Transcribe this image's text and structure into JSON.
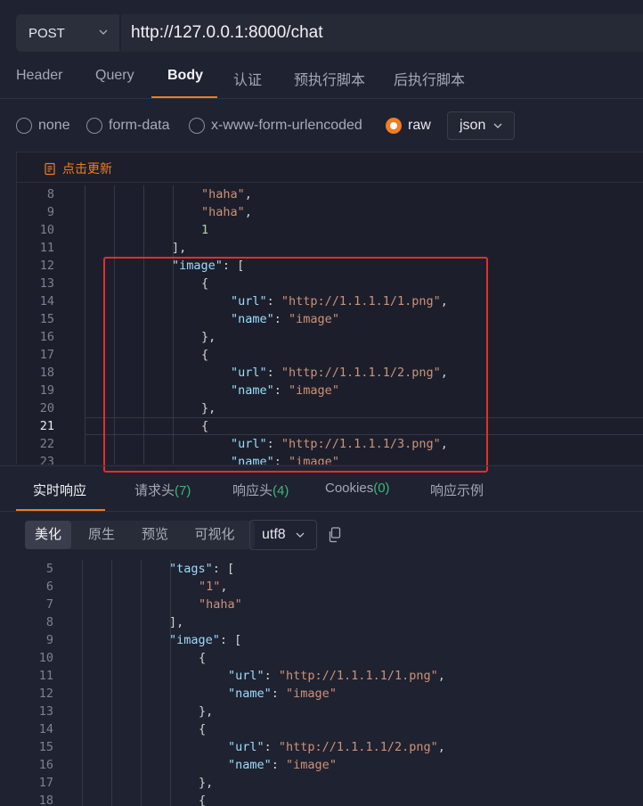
{
  "request": {
    "method": "POST",
    "url": "http://127.0.0.1:8000/chat",
    "tabs": [
      "Header",
      "Query",
      "Body",
      "认证",
      "预执行脚本",
      "后执行脚本"
    ],
    "active_tab": "Body"
  },
  "body_types": [
    "none",
    "form-data",
    "x-www-form-urlencoded",
    "raw"
  ],
  "body_type_selected": "raw",
  "raw_format": "json",
  "editor": {
    "update_label": "点击更新",
    "lines": [
      {
        "n": "8",
        "indent": 4,
        "parts": [
          [
            "s",
            "\"haha\""
          ],
          [
            "p",
            ","
          ]
        ]
      },
      {
        "n": "9",
        "indent": 4,
        "parts": [
          [
            "s",
            "\"haha\""
          ],
          [
            "p",
            ","
          ]
        ]
      },
      {
        "n": "10",
        "indent": 4,
        "parts": [
          [
            "n",
            "1"
          ]
        ]
      },
      {
        "n": "11",
        "indent": 3,
        "parts": [
          [
            "p",
            "],"
          ]
        ]
      },
      {
        "n": "12",
        "indent": 3,
        "parts": [
          [
            "k",
            "\"image\""
          ],
          [
            "p",
            ": ["
          ]
        ]
      },
      {
        "n": "13",
        "indent": 4,
        "parts": [
          [
            "p",
            "{"
          ]
        ]
      },
      {
        "n": "14",
        "indent": 5,
        "parts": [
          [
            "k",
            "\"url\""
          ],
          [
            "p",
            ": "
          ],
          [
            "s",
            "\"http://1.1.1.1/1.png\""
          ],
          [
            "p",
            ","
          ]
        ]
      },
      {
        "n": "15",
        "indent": 5,
        "parts": [
          [
            "k",
            "\"name\""
          ],
          [
            "p",
            ": "
          ],
          [
            "s",
            "\"image\""
          ]
        ]
      },
      {
        "n": "16",
        "indent": 4,
        "parts": [
          [
            "p",
            "},"
          ]
        ]
      },
      {
        "n": "17",
        "indent": 4,
        "parts": [
          [
            "p",
            "{"
          ]
        ]
      },
      {
        "n": "18",
        "indent": 5,
        "parts": [
          [
            "k",
            "\"url\""
          ],
          [
            "p",
            ": "
          ],
          [
            "s",
            "\"http://1.1.1.1/2.png\""
          ],
          [
            "p",
            ","
          ]
        ]
      },
      {
        "n": "19",
        "indent": 5,
        "parts": [
          [
            "k",
            "\"name\""
          ],
          [
            "p",
            ": "
          ],
          [
            "s",
            "\"image\""
          ]
        ]
      },
      {
        "n": "20",
        "indent": 4,
        "parts": [
          [
            "p",
            "},"
          ]
        ]
      },
      {
        "n": "21",
        "indent": 4,
        "parts": [
          [
            "p",
            "{"
          ]
        ]
      },
      {
        "n": "22",
        "indent": 5,
        "parts": [
          [
            "k",
            "\"url\""
          ],
          [
            "p",
            ": "
          ],
          [
            "s",
            "\"http://1.1.1.1/3.png\""
          ],
          [
            "p",
            ","
          ]
        ]
      },
      {
        "n": "23",
        "indent": 5,
        "parts": [
          [
            "k",
            "\"name\""
          ],
          [
            "p",
            ": "
          ],
          [
            "s",
            "\"image\""
          ]
        ]
      }
    ],
    "current_line": "21"
  },
  "response": {
    "tabs": [
      {
        "label": "实时响应",
        "count": ""
      },
      {
        "label": "请求头",
        "count": "(7)"
      },
      {
        "label": "响应头",
        "count": "(4)"
      },
      {
        "label": "Cookies",
        "count": "(0)"
      },
      {
        "label": "响应示例",
        "count": ""
      }
    ],
    "active_tab": "实时响应",
    "view_modes": [
      "美化",
      "原生",
      "预览",
      "可视化"
    ],
    "active_view": "美化",
    "encoding": "utf8",
    "lines": [
      {
        "n": "5",
        "indent": 3,
        "parts": [
          [
            "k",
            "\"tags\""
          ],
          [
            "p",
            ": ["
          ]
        ]
      },
      {
        "n": "6",
        "indent": 4,
        "parts": [
          [
            "s",
            "\"1\""
          ],
          [
            "p",
            ","
          ]
        ]
      },
      {
        "n": "7",
        "indent": 4,
        "parts": [
          [
            "s",
            "\"haha\""
          ]
        ]
      },
      {
        "n": "8",
        "indent": 3,
        "parts": [
          [
            "p",
            "],"
          ]
        ]
      },
      {
        "n": "9",
        "indent": 3,
        "parts": [
          [
            "k",
            "\"image\""
          ],
          [
            "p",
            ": ["
          ]
        ]
      },
      {
        "n": "10",
        "indent": 4,
        "parts": [
          [
            "p",
            "{"
          ]
        ]
      },
      {
        "n": "11",
        "indent": 5,
        "parts": [
          [
            "k",
            "\"url\""
          ],
          [
            "p",
            ": "
          ],
          [
            "s",
            "\"http://1.1.1.1/1.png\""
          ],
          [
            "p",
            ","
          ]
        ]
      },
      {
        "n": "12",
        "indent": 5,
        "parts": [
          [
            "k",
            "\"name\""
          ],
          [
            "p",
            ": "
          ],
          [
            "s",
            "\"image\""
          ]
        ]
      },
      {
        "n": "13",
        "indent": 4,
        "parts": [
          [
            "p",
            "},"
          ]
        ]
      },
      {
        "n": "14",
        "indent": 4,
        "parts": [
          [
            "p",
            "{"
          ]
        ]
      },
      {
        "n": "15",
        "indent": 5,
        "parts": [
          [
            "k",
            "\"url\""
          ],
          [
            "p",
            ": "
          ],
          [
            "s",
            "\"http://1.1.1.1/2.png\""
          ],
          [
            "p",
            ","
          ]
        ]
      },
      {
        "n": "16",
        "indent": 5,
        "parts": [
          [
            "k",
            "\"name\""
          ],
          [
            "p",
            ": "
          ],
          [
            "s",
            "\"image\""
          ]
        ]
      },
      {
        "n": "17",
        "indent": 4,
        "parts": [
          [
            "p",
            "},"
          ]
        ]
      },
      {
        "n": "18",
        "indent": 4,
        "parts": [
          [
            "p",
            "{"
          ]
        ]
      }
    ]
  },
  "colors": {
    "accent": "#f07d1f",
    "highlight_box": "#e0302a",
    "count_green": "#3cb878"
  }
}
